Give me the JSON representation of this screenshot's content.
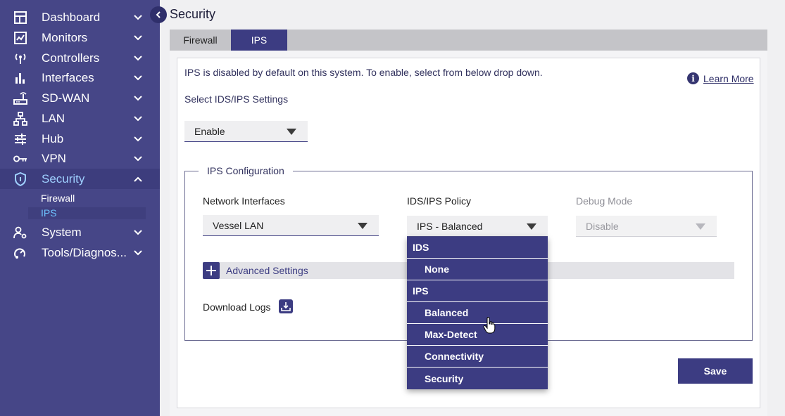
{
  "sidebar": {
    "items": [
      {
        "label": "Dashboard",
        "icon": "dashboard-icon"
      },
      {
        "label": "Monitors",
        "icon": "monitor-chart-icon"
      },
      {
        "label": "Controllers",
        "icon": "antenna-icon"
      },
      {
        "label": "Interfaces",
        "icon": "bar-chart-icon"
      },
      {
        "label": "SD-WAN",
        "icon": "router-icon"
      },
      {
        "label": "LAN",
        "icon": "network-tree-icon"
      },
      {
        "label": "Hub",
        "icon": "sliders-icon"
      },
      {
        "label": "VPN",
        "icon": "key-icon"
      },
      {
        "label": "Security",
        "icon": "shield-icon"
      },
      {
        "label": "System",
        "icon": "user-gear-icon"
      },
      {
        "label": "Tools/Diagnos...",
        "icon": "tools-icon"
      }
    ],
    "security_sub": [
      "Firewall",
      "IPS"
    ]
  },
  "page": {
    "title": "Security",
    "tabs": [
      "Firewall",
      "IPS"
    ],
    "info_text": "IPS is disabled by default on this system. To enable, select from below drop down.",
    "learn_more": "Learn More",
    "select_label": "Select IDS/IPS Settings",
    "select_value": "Enable",
    "config_legend": "IPS Configuration",
    "network_interfaces_label": "Network Interfaces",
    "network_interfaces_value": "Vessel LAN",
    "policy_label": "IDS/IPS Policy",
    "policy_value": "IPS - Balanced",
    "debug_label": "Debug Mode",
    "debug_value": "Disable",
    "advanced_label": "Advanced Settings",
    "download_label": "Download Logs",
    "save_label": "Save"
  },
  "dropdown": {
    "group_ids": "IDS",
    "ids_options": [
      "None"
    ],
    "group_ips": "IPS",
    "ips_options": [
      "Balanced",
      "Max-Detect",
      "Connectivity",
      "Security"
    ]
  },
  "colors": {
    "sidebar_bg": "#464687",
    "accent": "#3c3c82",
    "active_text": "#6ec3ff"
  }
}
